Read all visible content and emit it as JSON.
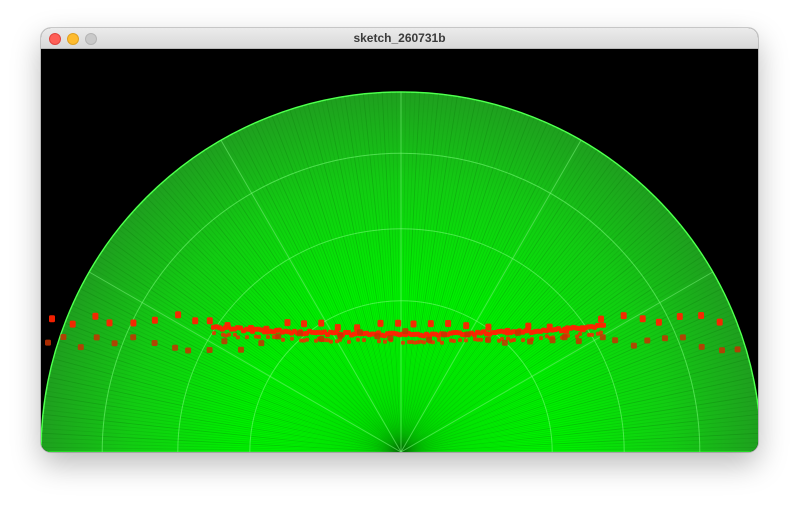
{
  "window": {
    "title": "sketch_260731b",
    "controls": [
      "close",
      "minimize",
      "maximize"
    ]
  },
  "canvas": {
    "background": "#000000",
    "accent_green": "#00ff00",
    "marker_red": "#ff2200",
    "marker_dark_red": "#c83200"
  }
}
